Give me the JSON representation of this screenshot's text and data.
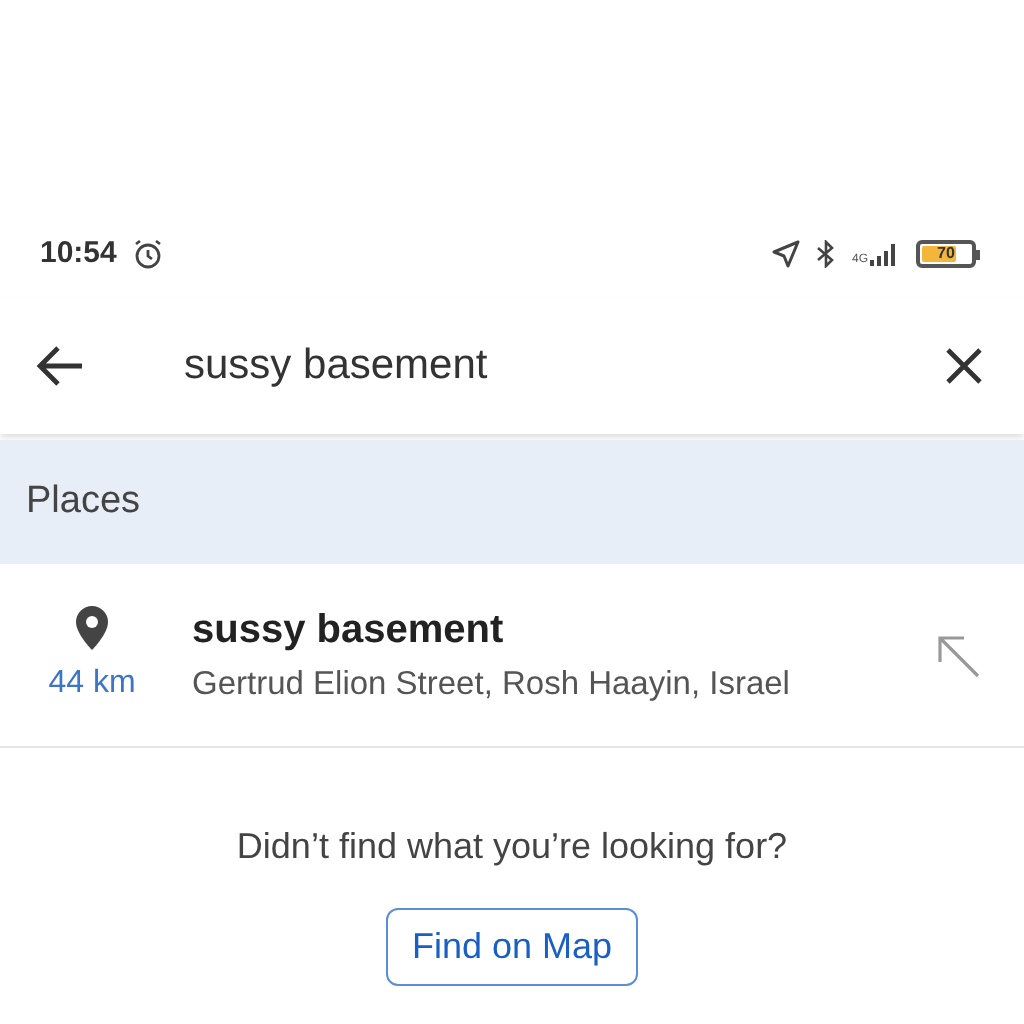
{
  "status_bar": {
    "time": "10:54",
    "network": "4G",
    "battery": "70"
  },
  "search": {
    "value": "sussy basement"
  },
  "section_title": "Places",
  "results": [
    {
      "name": "sussy basement",
      "distance": "44 km",
      "address": "Gertrud Elion Street, Rosh Haayin, Israel"
    }
  ],
  "footer": {
    "prompt": "Didn’t find what you’re looking for?",
    "button": "Find on Map"
  }
}
